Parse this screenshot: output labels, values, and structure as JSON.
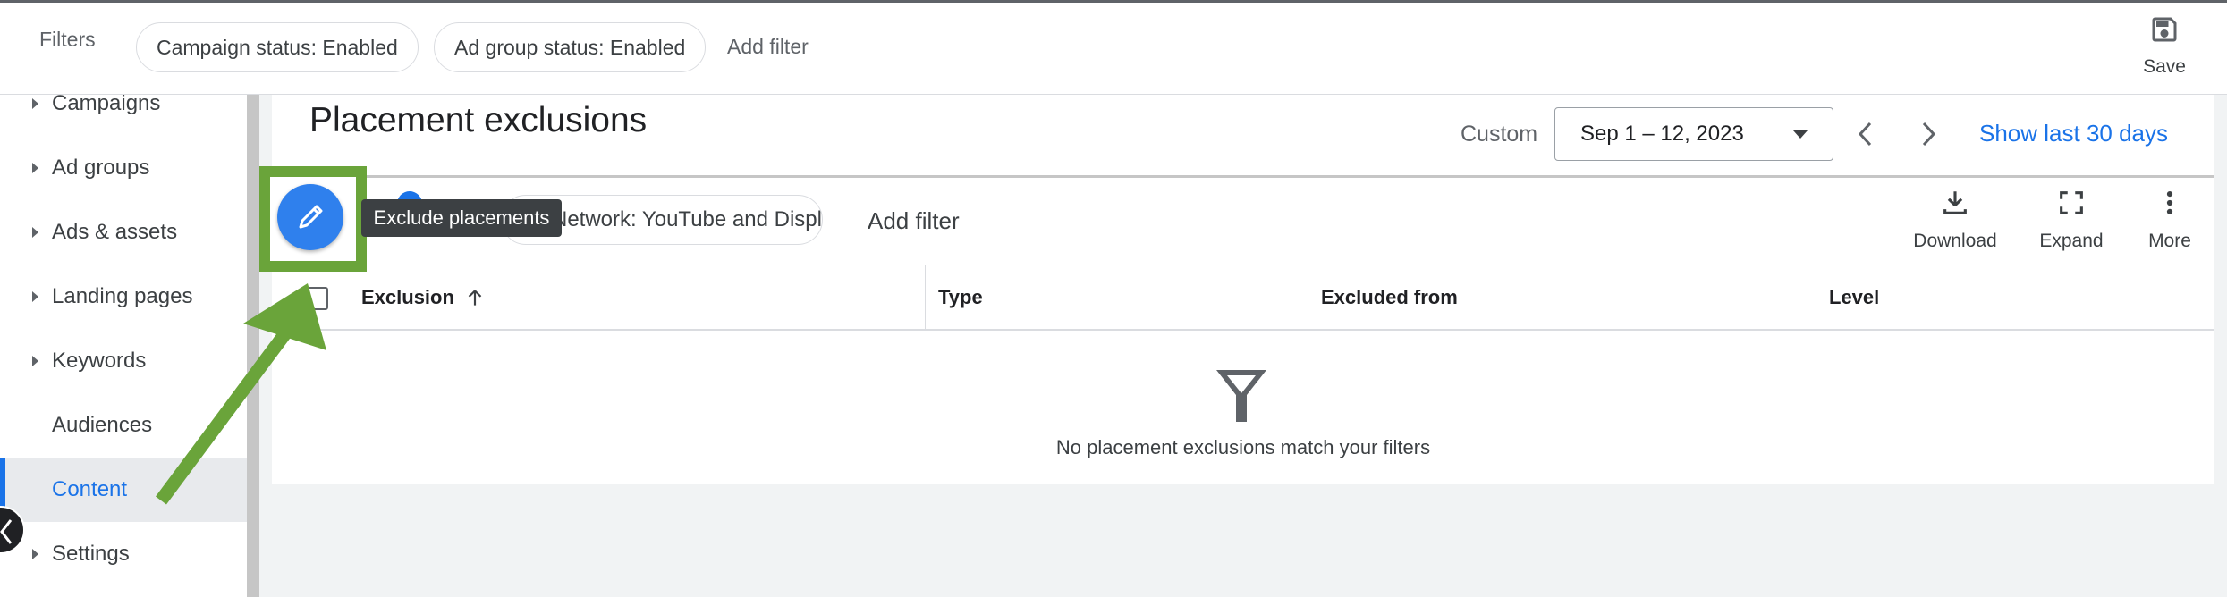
{
  "topbar": {
    "filters_label": "Filters",
    "chips": [
      "Campaign status: Enabled",
      "Ad group status: Enabled"
    ],
    "add_filter": "Add filter",
    "save_label": "Save"
  },
  "sidebar": {
    "items": [
      {
        "label": "Campaigns",
        "caret": true
      },
      {
        "label": "Ad groups",
        "caret": true
      },
      {
        "label": "Ads & assets",
        "caret": true
      },
      {
        "label": "Landing pages",
        "caret": true
      },
      {
        "label": "Keywords",
        "caret": true
      },
      {
        "label": "Audiences",
        "caret": false
      },
      {
        "label": "Content",
        "caret": false,
        "active": true
      },
      {
        "label": "Settings",
        "caret": true
      }
    ]
  },
  "header": {
    "title": "Placement exclusions",
    "date_mode": "Custom",
    "date_range": "Sep 1 – 12, 2023",
    "show_last": "Show last 30 days"
  },
  "toolbar": {
    "segment_chip": "Network: YouTube and Display",
    "add_filter": "Add filter",
    "tooltip": "Exclude placements",
    "download": "Download",
    "expand": "Expand",
    "more": "More"
  },
  "table": {
    "columns": [
      "Exclusion",
      "Type",
      "Excluded from",
      "Level"
    ],
    "empty_message": "No placement exclusions match your filters"
  },
  "colors": {
    "accent": "#1a73e8",
    "highlight": "#6aa43a"
  }
}
